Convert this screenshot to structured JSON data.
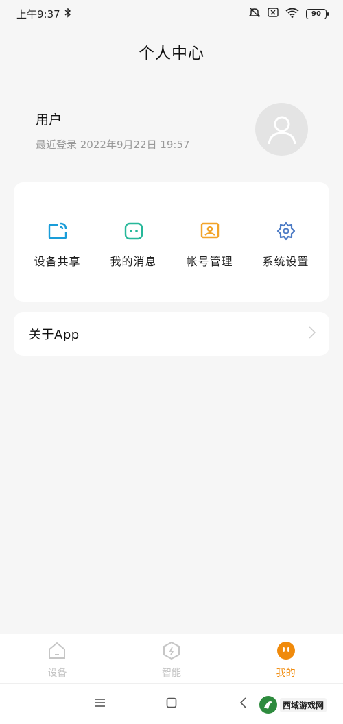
{
  "status_bar": {
    "time": "上午9:37",
    "battery": "90"
  },
  "header": {
    "title": "个人中心"
  },
  "user": {
    "name": "用户",
    "last_login": "最近登录 2022年9月22日 19:57"
  },
  "menu": [
    {
      "label": "设备共享",
      "icon": "device-share-icon",
      "color": "#1a9dd9"
    },
    {
      "label": "我的消息",
      "icon": "message-icon",
      "color": "#27b89a"
    },
    {
      "label": "帐号管理",
      "icon": "account-icon",
      "color": "#f2a42a"
    },
    {
      "label": "系统设置",
      "icon": "gear-icon",
      "color": "#4a79c4"
    }
  ],
  "about": {
    "label": "关于App"
  },
  "tabs": [
    {
      "label": "设备",
      "icon": "home-icon",
      "active": false
    },
    {
      "label": "智能",
      "icon": "smart-icon",
      "active": false
    },
    {
      "label": "我的",
      "icon": "me-icon",
      "active": true
    }
  ],
  "colors": {
    "accent": "#f08a0b",
    "inactive_tab": "#c6c6c6",
    "background": "#f6f6f6"
  },
  "watermark": {
    "text": "西域游戏网"
  }
}
